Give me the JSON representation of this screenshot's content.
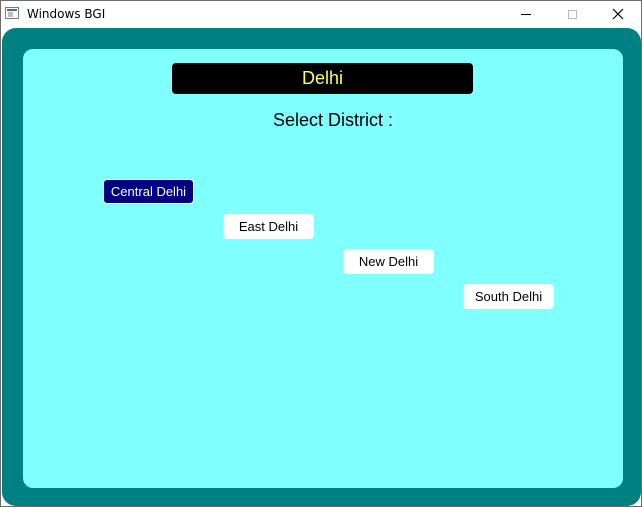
{
  "window": {
    "title": "Windows BGI",
    "icon": "window-app-icon",
    "controls": {
      "minimize_icon": "minimize-icon",
      "maximize_icon": "maximize-icon",
      "close_icon": "close-icon",
      "close_glyph": "✕"
    }
  },
  "colors": {
    "outer_frame": "#008080",
    "inner_panel": "#80ffff",
    "header_bg": "#000000",
    "header_text": "#ffff55",
    "selected_bg": "#000080",
    "selected_text": "#ffffff",
    "button_bg": "#ffffff"
  },
  "header": {
    "state_name": "Delhi"
  },
  "prompt": {
    "label": "Select District :"
  },
  "districts": [
    {
      "label": "Central Delhi",
      "selected": true
    },
    {
      "label": "East Delhi",
      "selected": false
    },
    {
      "label": "New Delhi",
      "selected": false
    },
    {
      "label": "South Delhi",
      "selected": false
    }
  ]
}
